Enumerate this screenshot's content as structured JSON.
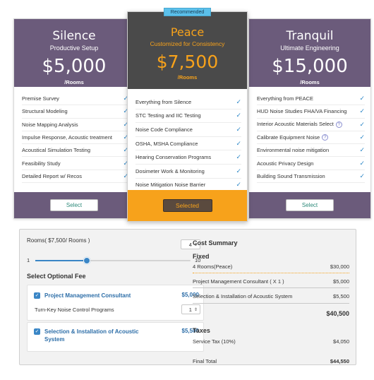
{
  "plans": [
    {
      "name": "Silence",
      "subtitle": "Productive Setup",
      "price": "$5,000",
      "unit": "/Rooms",
      "button": "Select",
      "features": [
        {
          "label": "Premise Survey",
          "help": false
        },
        {
          "label": "Structural Modeling",
          "help": false
        },
        {
          "label": "Noise Mapping Analysis",
          "help": false
        },
        {
          "label": "Impulse Response, Acoustic treatment",
          "help": false
        },
        {
          "label": "Acoustical Simulation Testing",
          "help": false
        },
        {
          "label": "Feasibility Study",
          "help": false
        },
        {
          "label": "Detailed Report w/ Recos",
          "help": false
        }
      ]
    },
    {
      "name": "Peace",
      "subtitle": "Customized for Consistency",
      "price": "$7,500",
      "unit": "/Rooms",
      "badge": "Recommended",
      "button": "Selected",
      "features": [
        {
          "label": "Everything from Silence",
          "help": false
        },
        {
          "label": "STC Testing and IIC Testing",
          "help": false
        },
        {
          "label": "Noise Code Compliance",
          "help": false
        },
        {
          "label": "OSHA, MSHA Compliance",
          "help": false
        },
        {
          "label": "Hearing Conservation Programs",
          "help": false
        },
        {
          "label": "Dosimeter Work & Monitoring",
          "help": false
        },
        {
          "label": "Noise Mitigation Noise Barrier",
          "help": false
        }
      ]
    },
    {
      "name": "Tranquil",
      "subtitle": "Ultimate Engineering",
      "price": "$15,000",
      "unit": "/Rooms",
      "button": "Select",
      "features": [
        {
          "label": "Everything from PEACE",
          "help": false
        },
        {
          "label": "HUD Noise Studies FHA/VA Financing",
          "help": false
        },
        {
          "label": "Interior Acoustic Materials Select",
          "help": true
        },
        {
          "label": "Calibrate Equipment Noise",
          "help": true
        },
        {
          "label": "Environmental noise mitigation",
          "help": false
        },
        {
          "label": "Acoustic Privacy Design",
          "help": false
        },
        {
          "label": "Building Sound Transmission",
          "help": false
        }
      ]
    }
  ],
  "icons": {
    "check": "check-icon",
    "help": "question-circle-icon",
    "stepper": "up-down-arrows-icon"
  },
  "colors": {
    "purple": "#6b5b7b",
    "dark": "#4a4a4a",
    "orange": "#f7a21b",
    "blue": "#3a86c6",
    "badge": "#5bc0eb"
  },
  "calculator": {
    "rooms_label": "Rooms( $7,500/ Rooms )",
    "rooms_value": "4",
    "slider_min": "1",
    "slider_max": "10",
    "slider_fraction": 0.333,
    "optional_title": "Select Optional Fee",
    "options": [
      {
        "name": "Project Management Consultant",
        "price": "$5,000",
        "checked": true
      },
      {
        "name": "Selection & Installation of Acoustic System",
        "price": "$5,500",
        "checked": true
      }
    ],
    "sub_label": "Turn-Key Noise Control Programs",
    "sub_value": "1"
  },
  "summary": {
    "title": "Cost Summary",
    "fixed_title": "Fixed",
    "fixed_rows": [
      {
        "label": "4 Rooms(Peace)",
        "value": "$30,000"
      },
      {
        "label": "Project Management Consultant ( X 1 )",
        "value": "$5,000"
      },
      {
        "label": "Selection & Installation of Acoustic System",
        "value": "$5,500"
      }
    ],
    "fixed_total": "$40,500",
    "taxes_title": "Taxes",
    "tax_label": "Service Tax (10%)",
    "tax_value": "$4,050",
    "final_label": "Final Total",
    "final_value": "$44,550"
  }
}
